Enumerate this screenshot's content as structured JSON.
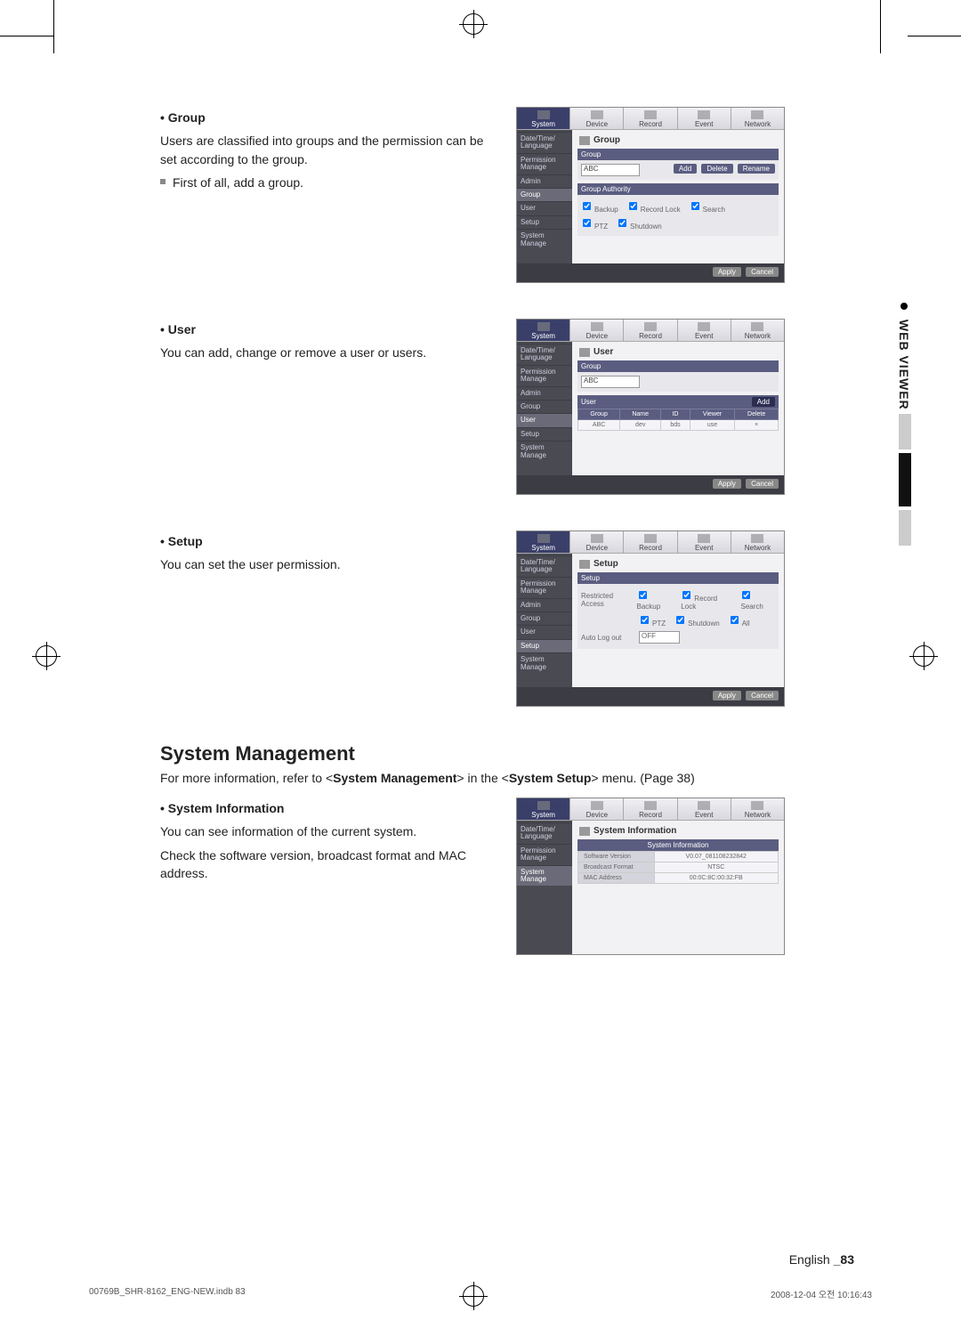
{
  "sections": {
    "group": {
      "heading": "• Group",
      "p1": "Users are classified into groups and the permission can be set according to the group.",
      "sub1": "First of all, add a group."
    },
    "user": {
      "heading": "• User",
      "p1": "You can add, change or remove a user or users."
    },
    "setup": {
      "heading": "• Setup",
      "p1": "You can set the user permission."
    },
    "sysmgmt": {
      "heading": "System Management",
      "sub_pre": "For more information, refer to <",
      "sub_bold": "System Management",
      "sub_mid": "> in the <",
      "sub_bold2": "System Setup",
      "sub_post": "> menu. (Page 38)"
    },
    "sysinfo": {
      "heading": "• System Information",
      "p1": "You can see information of the current system.",
      "p2": "Check the software version, broadcast format and MAC address."
    }
  },
  "side_tab": "WEB VIEWER",
  "footer": {
    "lang": "English",
    "page": "_83"
  },
  "printinfo": {
    "left": "00769B_SHR-8162_ENG-NEW.indb   83",
    "right": "2008-12-04   오전 10:16:43"
  },
  "ui_common": {
    "tabs": [
      "System",
      "Device",
      "Record",
      "Event",
      "Network"
    ],
    "side_items": [
      "Date/Time/ Language",
      "Permission Manage",
      "Admin",
      "Group",
      "User",
      "Setup",
      "System Manage"
    ],
    "apply": "Apply",
    "cancel": "Cancel"
  },
  "ui_group": {
    "title": "Group",
    "panel1_hdr": "Group",
    "dropdown": "ABC",
    "btn_add": "Add",
    "btn_delete": "Delete",
    "btn_rename": "Rename",
    "panel2_hdr": "Group Authority",
    "chk": [
      "Backup",
      "Record Lock",
      "Search",
      "PTZ",
      "Shutdown"
    ]
  },
  "ui_user": {
    "title": "User",
    "panel1_hdr": "Group",
    "dropdown": "ABC",
    "panel2_hdr": "User",
    "btn_add": "Add",
    "cols": [
      "Group",
      "Name",
      "ID",
      "Viewer",
      "Delete"
    ],
    "row": [
      "ABC",
      "dev",
      "bds",
      "use",
      "×"
    ]
  },
  "ui_setup": {
    "title": "Setup",
    "panel_hdr": "Setup",
    "row1_label": "Restricted Access",
    "row1_chk": [
      "Backup",
      "Record Lock",
      "Search",
      "PTZ",
      "Shutdown",
      "All"
    ],
    "row2_label": "Auto Log out",
    "row2_val": "OFF"
  },
  "ui_sysinfo": {
    "title": "System Information",
    "panel_hdr": "System Information",
    "rows": [
      [
        "Software Version",
        "V0.07_081108232842"
      ],
      [
        "Broadcast Format",
        "NTSC"
      ],
      [
        "MAC Address",
        "00:0C:8C:00:32:FB"
      ]
    ]
  }
}
